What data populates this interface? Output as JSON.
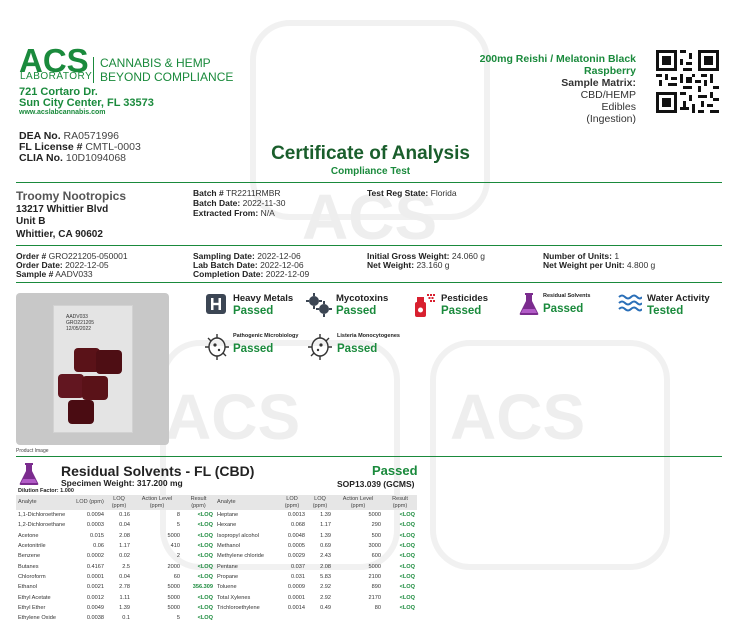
{
  "header": {
    "logo_main": "ACS",
    "logo_sub": "LABORATORY",
    "tagline_1": "CANNABIS & HEMP",
    "tagline_2": "BEYOND COMPLIANCE",
    "address_1": "721 Cortaro Dr.",
    "address_2": "Sun City Center, FL 33573",
    "website": "www.acslabcannabis.com",
    "dea_label": "DEA No.",
    "dea_value": "RA0571996",
    "fl_label": "FL License #",
    "fl_value": "CMTL-0003",
    "clia_label": "CLIA No.",
    "clia_value": "10D1094068"
  },
  "product": {
    "name_1": "200mg Reishi / Melatonin Black",
    "name_2": "Raspberry",
    "matrix_label": "Sample Matrix:",
    "matrix_1": "CBD/HEMP",
    "matrix_2": "Edibles",
    "matrix_3": "(Ingestion)"
  },
  "title": {
    "main": "Certificate of Analysis",
    "sub": "Compliance Test"
  },
  "client": {
    "name": "Troomy Nootropics",
    "line_1": "13217 Whittier Blvd",
    "line_2": "Unit B",
    "line_3": "Whittier, CA 90602"
  },
  "batch": {
    "batch_label": "Batch #",
    "batch_value": "TR2211RMBR",
    "batch_date_label": "Batch Date:",
    "batch_date_value": "2022-11-30",
    "extracted_label": "Extracted From:",
    "extracted_value": "N/A",
    "test_reg_label": "Test Reg State:",
    "test_reg_value": "Florida"
  },
  "order": {
    "order_label": "Order #",
    "order_value": "GRO221205-050001",
    "order_date_label": "Order Date:",
    "order_date_value": "2022-12-05",
    "sample_label": "Sample #",
    "sample_value": "AADV033",
    "sampling_label": "Sampling Date:",
    "sampling_value": "2022-12-06",
    "lab_batch_label": "Lab Batch Date:",
    "lab_batch_value": "2022-12-06",
    "completion_label": "Completion Date:",
    "completion_value": "2022-12-09",
    "gross_label": "Initial Gross Weight:",
    "gross_value": "24.060 g",
    "net_label": "Net Weight:",
    "net_value": "23.160 g",
    "units_label": "Number of Units:",
    "units_value": "1",
    "per_unit_label": "Net Weight per Unit:",
    "per_unit_value": "4.800 g"
  },
  "photo": {
    "label_1": "AADV033",
    "label_2": "GRO221205",
    "label_3": "12/05/2022",
    "caption": "Product Image"
  },
  "tests": {
    "heavy_metals": {
      "title": "Heavy Metals",
      "status": "Passed"
    },
    "mycotoxins": {
      "title": "Mycotoxins",
      "status": "Passed"
    },
    "pesticides": {
      "title": "Pesticides",
      "status": "Passed"
    },
    "residual": {
      "title": "Residual Solvents",
      "status": "Passed"
    },
    "water": {
      "title": "Water Activity",
      "status": "Tested"
    },
    "pathogenic": {
      "title": "Pathogenic Microbiology",
      "status": "Passed"
    },
    "listeria": {
      "title": "Listeria Monocytogenes",
      "status": "Passed"
    }
  },
  "residual_solvents": {
    "title": "Residual Solvents - FL (CBD)",
    "status": "Passed",
    "specimen": "Specimen Weight: 317.200 mg",
    "sop": "SOP13.039 (GCMS)",
    "dilution": "Dilution Factor: 1.000",
    "headers": [
      "Analyte",
      "LOD (ppm)",
      "LOQ (ppm)",
      "Action Level (ppm)",
      "Result (ppm)"
    ],
    "left_rows": [
      [
        "1,1-Dichloroethene",
        "0.0094",
        "0.16",
        "8",
        "<LOQ"
      ],
      [
        "1,2-Dichloroethane",
        "0.0003",
        "0.04",
        "5",
        "<LOQ"
      ],
      [
        "Acetone",
        "0.015",
        "2.08",
        "5000",
        "<LOQ"
      ],
      [
        "Acetonitrile",
        "0.06",
        "1.17",
        "410",
        "<LOQ"
      ],
      [
        "Benzene",
        "0.0002",
        "0.02",
        "2",
        "<LOQ"
      ],
      [
        "Butanes",
        "0.4167",
        "2.5",
        "2000",
        "<LOQ"
      ],
      [
        "Chloroform",
        "0.0001",
        "0.04",
        "60",
        "<LOQ"
      ],
      [
        "Ethanol",
        "0.0021",
        "2.78",
        "5000",
        "356.309"
      ],
      [
        "Ethyl Acetate",
        "0.0012",
        "1.11",
        "5000",
        "<LOQ"
      ],
      [
        "Ethyl Ether",
        "0.0049",
        "1.39",
        "5000",
        "<LOQ"
      ],
      [
        "Ethylene Oxide",
        "0.0038",
        "0.1",
        "5",
        "<LOQ"
      ]
    ],
    "right_rows": [
      [
        "Heptane",
        "0.0013",
        "1.39",
        "5000",
        "<LOQ"
      ],
      [
        "Hexane",
        "0.068",
        "1.17",
        "290",
        "<LOQ"
      ],
      [
        "Isopropyl alcohol",
        "0.0048",
        "1.39",
        "500",
        "<LOQ"
      ],
      [
        "Methanol",
        "0.0005",
        "0.69",
        "3000",
        "<LOQ"
      ],
      [
        "Methylene chloride",
        "0.0029",
        "2.43",
        "600",
        "<LOQ"
      ],
      [
        "Pentane",
        "0.037",
        "2.08",
        "5000",
        "<LOQ"
      ],
      [
        "Propane",
        "0.031",
        "5.83",
        "2100",
        "<LOQ"
      ],
      [
        "Toluene",
        "0.0009",
        "2.92",
        "890",
        "<LOQ"
      ],
      [
        "Total Xylenes",
        "0.0001",
        "2.92",
        "2170",
        "<LOQ"
      ],
      [
        "Trichloroethylene",
        "0.0014",
        "0.49",
        "80",
        "<LOQ"
      ]
    ]
  },
  "watermark": "ACS",
  "colors": {
    "brand_green": "#1a8a3c",
    "title_green": "#1a5e2c",
    "gummy": "#5a1218"
  }
}
